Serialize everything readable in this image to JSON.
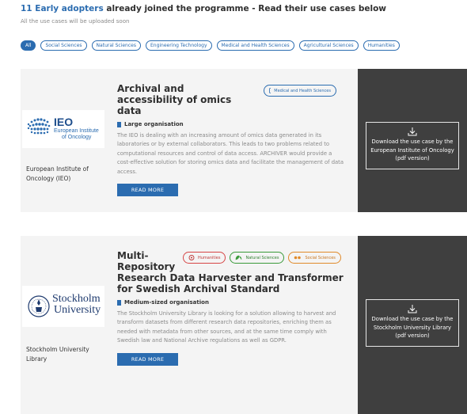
{
  "page": {
    "heading_accent": "11 Early adopters",
    "heading_rest": " already joined the programme - Read their use cases below",
    "subheading": "All the use cases will be uploaded soon"
  },
  "filters": [
    {
      "label": "All",
      "active": true
    },
    {
      "label": "Social Sciences",
      "active": false
    },
    {
      "label": "Natural Sciences",
      "active": false
    },
    {
      "label": "Engineering Technology",
      "active": false
    },
    {
      "label": "Medical and Health Sciences",
      "active": false
    },
    {
      "label": "Agricultural Sciences",
      "active": false
    },
    {
      "label": "Humanities",
      "active": false
    }
  ],
  "cases": [
    {
      "logo_main": "IEO",
      "logo_sub1": "European Institute",
      "logo_sub2": "of Oncology",
      "org_name": "European Institute of Oncology (IEO)",
      "title": "Archival and accessibility of omics data",
      "tags": [
        {
          "label": "Medical and Health Sciences",
          "icon": "medical-icon"
        }
      ],
      "org_type": "Large organisation",
      "description": "The IEO is dealing with an increasing amount of omics data generated in its laboratories or by external collaborators. This leads to two problems related to computational resources and control of data access. ARCHIVER would provide a cost-effective solution for storing omics data and facilitate the management of data access.",
      "read_more": "READ MORE",
      "download": "Download the use case by the European Institute of Oncology (pdf version)"
    },
    {
      "logo_main1": "Stockholm",
      "logo_main2": "University",
      "org_name": "Stockholm University Library",
      "title_short": "Multi-Repository",
      "title_rest": "Research Data Harvester and Transformer for Swedish Archival Standard",
      "tags": [
        {
          "label": "Humanities",
          "icon": "humanities-icon"
        },
        {
          "label": "Natural Sciences",
          "icon": "natural-sciences-icon"
        },
        {
          "label": "Social Sciences",
          "icon": "social-sciences-icon"
        }
      ],
      "org_type": "Medium-sized organisation",
      "description": "The Stockholm University Library is looking for a solution allowing to harvest and transform datasets from different research data repositories, enriching them as needed with metadata from other sources, and at the same time comply with Swedish law and National Archive regulations as well as GDPR.",
      "read_more": "READ MORE",
      "download": "Download the use case by the Stockholm University Library (pdf version)"
    }
  ],
  "colors": {
    "accent": "#2b6cb0",
    "panel": "#3f3f3f",
    "card": "#f4f4f4"
  }
}
